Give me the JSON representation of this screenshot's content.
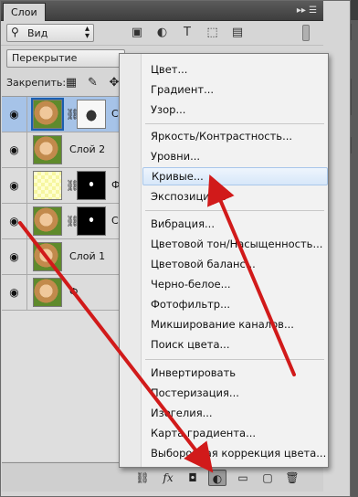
{
  "panel": {
    "tab_label": "Слои",
    "collapse_glyph": "▸▸ ☰",
    "kind_filter": "Вид",
    "blend_mode": "Перекрытие",
    "lock_label": "Закрепить:"
  },
  "layers": [
    {
      "name": "С",
      "type": "adjustment-photo-mask",
      "selected": true
    },
    {
      "name": "Слой 2",
      "type": "photo",
      "selected": false
    },
    {
      "name": "Ф",
      "type": "adjustment-mask",
      "selected": false
    },
    {
      "name": "С",
      "type": "photo-mask",
      "selected": false
    },
    {
      "name": "Слой 1",
      "type": "photo",
      "selected": false
    },
    {
      "name": "Ф",
      "type": "photo",
      "selected": false
    }
  ],
  "menu": {
    "items": [
      "Цвет...",
      "Градиент...",
      "Узор...",
      "Яркость/Контрастность...",
      "Уровни...",
      "Кривые...",
      "Экспозиция...",
      "Вибрация...",
      "Цветовой тон/Насыщенность...",
      "Цветовой баланс...",
      "Черно-белое...",
      "Фотофильтр...",
      "Микширование каналов...",
      "Поиск цвета...",
      "Инвертировать",
      "Постеризация...",
      "Изогелия...",
      "Карта градиента...",
      "Выборочная коррекция цвета..."
    ],
    "highlighted": "Кривые..."
  },
  "bottom_bar": {
    "fx_label": "fx"
  },
  "colors": {
    "arrow": "#d11a1a",
    "selection": "#a6c3e8",
    "menu_highlight": "#d7e7f9"
  }
}
